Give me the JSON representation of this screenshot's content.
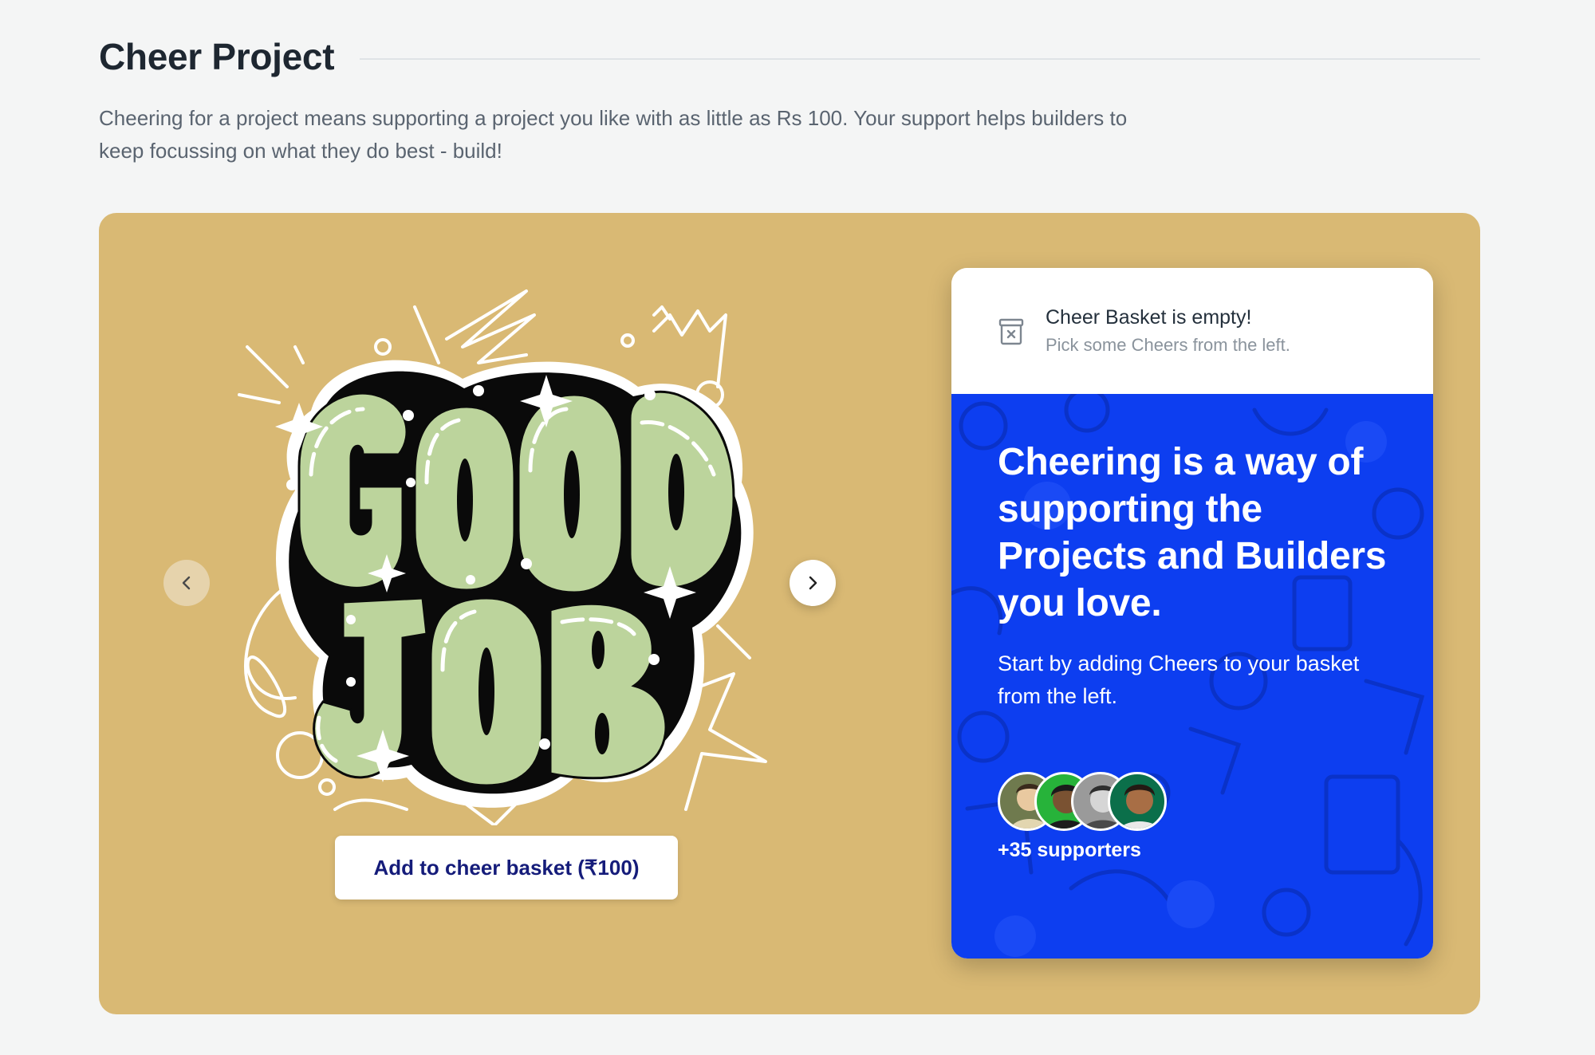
{
  "header": {
    "title": "Cheer Project",
    "description": "Cheering for a project means supporting a project you like with as little as Rs 100. Your support helps builders to keep focussing on what they do best - build!"
  },
  "carousel": {
    "prev_icon": "chevron-left-icon",
    "next_icon": "chevron-right-icon",
    "sticker_text_line1": "GOOD",
    "sticker_text_line2": "JOB",
    "add_button_label": "Add to cheer basket (₹100)"
  },
  "basket": {
    "icon": "empty-box-icon",
    "empty_title": "Cheer Basket is empty!",
    "empty_subtitle": "Pick some Cheers from the left."
  },
  "promo": {
    "title": "Cheering is a way of supporting the Projects and Builders you love.",
    "subtitle": "Start by adding Cheers to your basket from the left.",
    "supporters": "+35 supporters"
  },
  "colors": {
    "page_bg": "#f4f5f5",
    "panel_bg": "#d9b974",
    "promo_bg": "#0d3ef0",
    "button_text": "#151c7a",
    "sticker_green": "#bcd49c"
  }
}
